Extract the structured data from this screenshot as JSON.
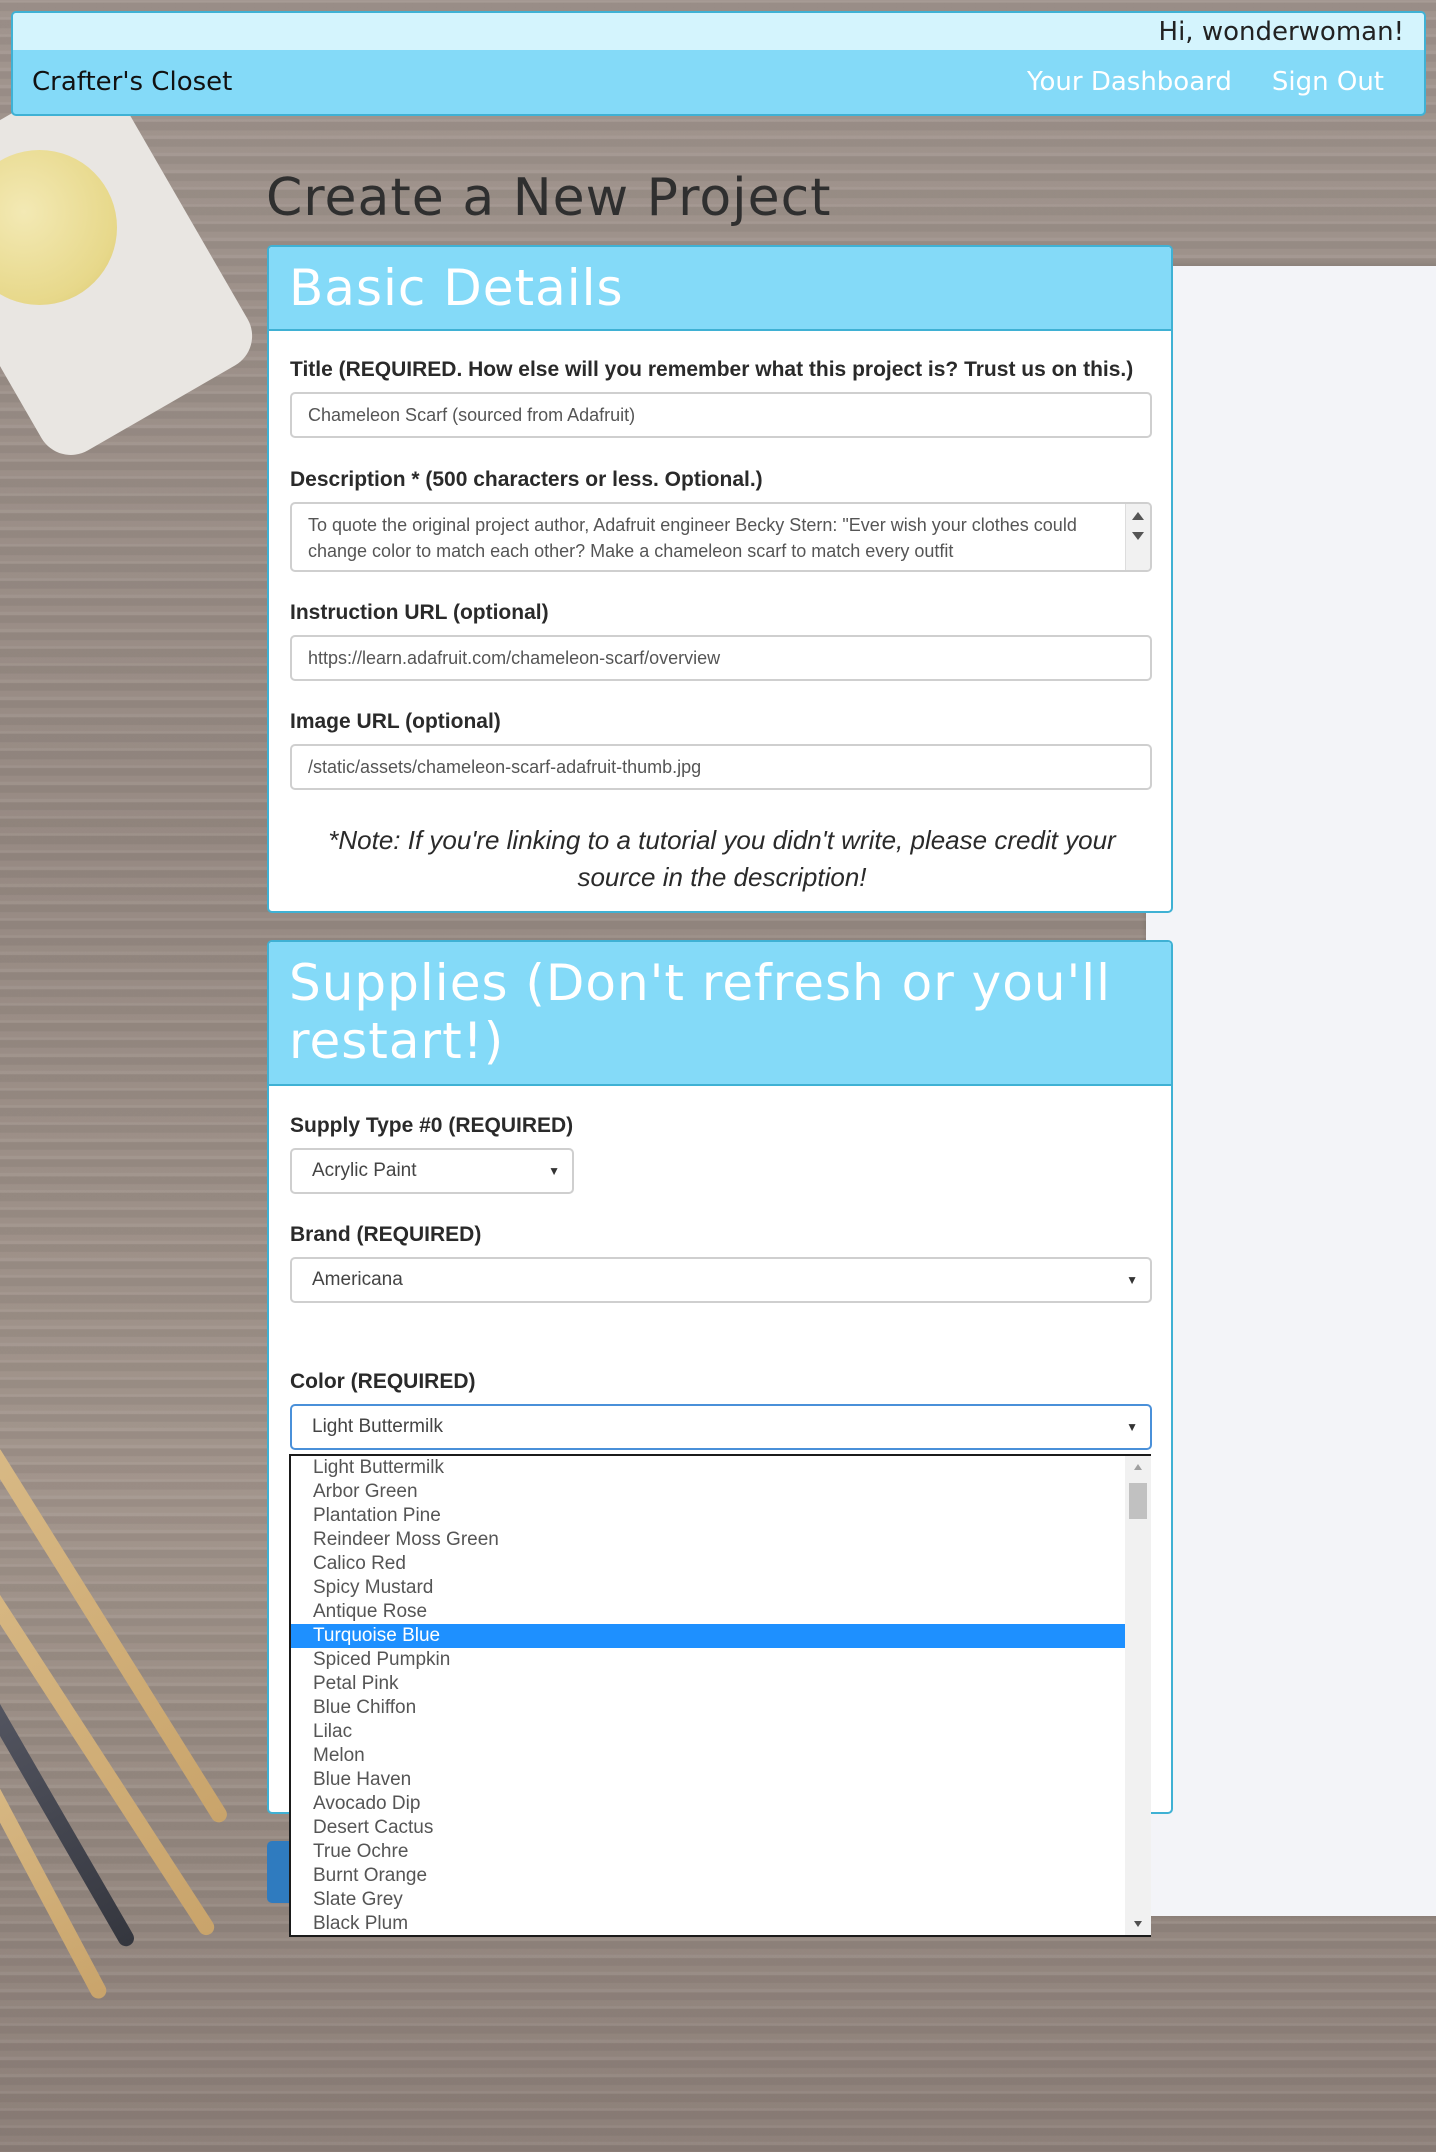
{
  "navbar": {
    "greeting": "Hi, wonderwoman!",
    "brand": "Crafter's Closet",
    "links": [
      "Your Dashboard",
      "Sign Out"
    ]
  },
  "page": {
    "title": "Create a New Project"
  },
  "basic_details": {
    "heading": "Basic Details",
    "title_label": "Title (REQUIRED. How else will you remember what this project is? Trust us on this.)",
    "title_value": "Chameleon Scarf (sourced from Adafruit)",
    "description_label": "Description * (500 characters or less. Optional.)",
    "description_value": "To quote the original project author, Adafruit engineer Becky Stern: \"Ever wish your clothes could change color to match each other? Make a chameleon scarf to match every outfit",
    "instruction_label": "Instruction URL (optional)",
    "instruction_value": "https://learn.adafruit.com/chameleon-scarf/overview",
    "image_label": "Image URL (optional)",
    "image_value": "/static/assets/chameleon-scarf-adafruit-thumb.jpg",
    "note": "*Note: If you're linking to a tutorial you didn't write, please credit your source in the description!"
  },
  "supplies": {
    "heading": "Supplies (Don't refresh or you'll restart!)",
    "supply_type_label": "Supply Type #0 (REQUIRED)",
    "supply_type_value": "Acrylic Paint",
    "brand_label": "Brand (REQUIRED)",
    "brand_value": "Americana",
    "color_label": "Color (REQUIRED)",
    "color_value": "Light Buttermilk",
    "color_options": [
      "Light Buttermilk",
      "Arbor Green",
      "Plantation Pine",
      "Reindeer Moss Green",
      "Calico Red",
      "Spicy Mustard",
      "Antique Rose",
      "Turquoise Blue",
      "Spiced Pumpkin",
      "Petal Pink",
      "Blue Chiffon",
      "Lilac",
      "Melon",
      "Blue Haven",
      "Avocado Dip",
      "Desert Cactus",
      "True Ochre",
      "Burnt Orange",
      "Slate Grey",
      "Black Plum"
    ],
    "highlighted_option": "Turquoise Blue"
  },
  "colors": {
    "accent": "#84daf8",
    "border": "#3fb1d4",
    "highlight": "#1e90ff"
  }
}
